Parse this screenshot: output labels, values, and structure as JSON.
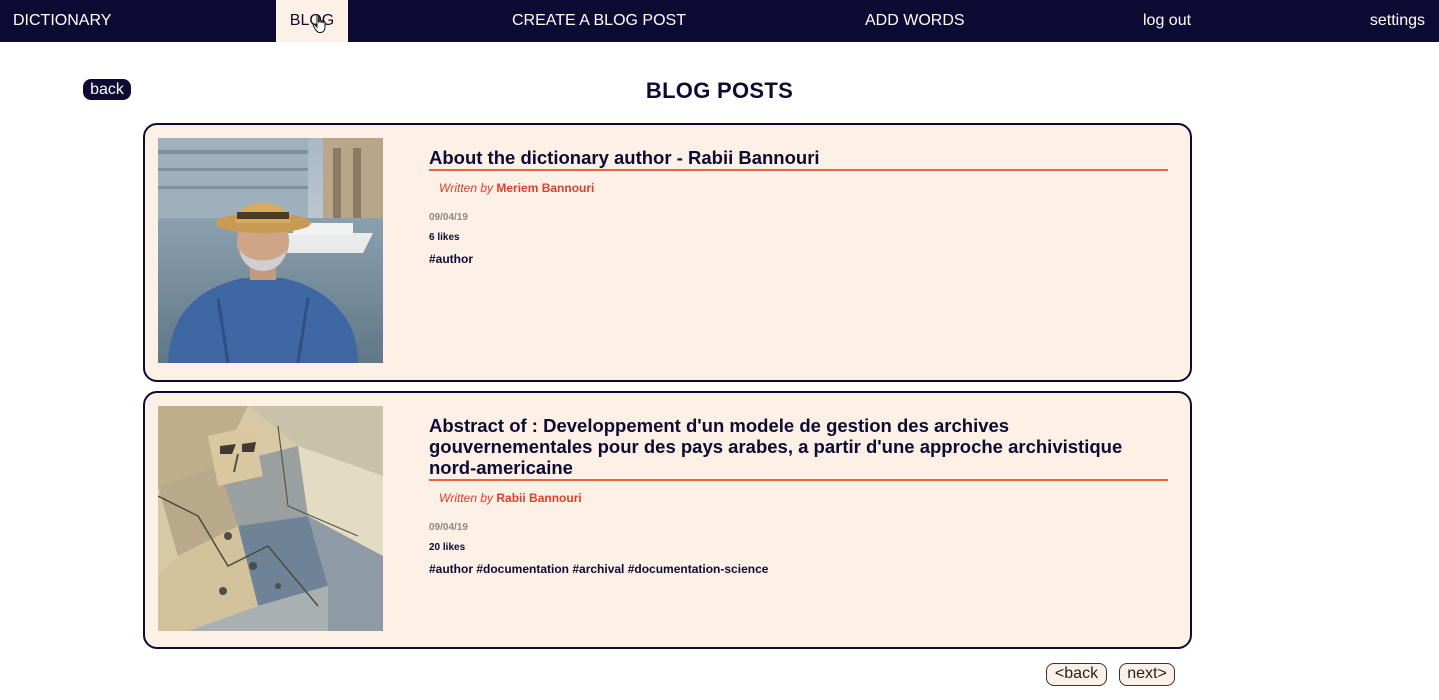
{
  "nav": {
    "dictionary": "DICTIONARY",
    "blog": "BLOG",
    "create": "CREATE A BLOG POST",
    "add_words": "ADD WORDS",
    "logout": "log out",
    "settings": "settings"
  },
  "header": {
    "back_label": "back",
    "title": "BLOG POSTS"
  },
  "posts": [
    {
      "title": "About the dictionary author - Rabii Bannouri",
      "written_by": "Written by",
      "author": "Meriem Bannouri",
      "date": "09/04/19",
      "likes": "6 likes",
      "tags": "#author",
      "image": "author-portrait-photo"
    },
    {
      "title": "Abstract of : Developpement d'un modele de gestion des archives gouvernementales pour des pays arabes, a partir d'une approche archivistique nord-americaine",
      "written_by": "Written by",
      "author": "Rabii Bannouri",
      "date": "09/04/19",
      "likes": "20 likes",
      "tags": "#author #documentation #archival #documentation-science",
      "image": "cubist-portrait-painting"
    }
  ],
  "pagination": {
    "back_label": "<back",
    "next_label": "next>"
  },
  "colors": {
    "navy": "#0d0b33",
    "cream": "#fdf0e6",
    "accent": "#e8643c",
    "author_red": "#d9412a"
  }
}
